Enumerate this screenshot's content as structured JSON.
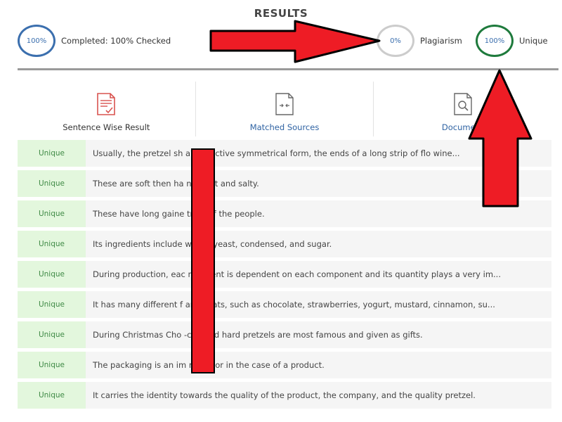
{
  "header": {
    "title": "RESULTS"
  },
  "stats": {
    "completed": {
      "ring": "100%",
      "label": "Completed: 100% Checked",
      "color": "#3b6fae"
    },
    "plagiarism": {
      "ring": "0%",
      "label": "Plagiarism",
      "color": "#cccccc"
    },
    "unique": {
      "ring": "100%",
      "label": "Unique",
      "color": "#1e7a3c"
    }
  },
  "tabs": [
    {
      "label": "Sentence Wise Result",
      "icon": "document-check-icon"
    },
    {
      "label": "Matched Sources",
      "icon": "document-compare-icon"
    },
    {
      "label": "Document",
      "icon": "document-search-icon"
    }
  ],
  "rows": [
    {
      "status": "Unique",
      "text": "Usually, the pretzel sh a distinctive symmetrical form, the ends of a long strip of flo wine..."
    },
    {
      "status": "Unique",
      "text": "These are soft then ha n sweet and salty."
    },
    {
      "status": "Unique",
      "text": "These have long gaine trust of the people."
    },
    {
      "status": "Unique",
      "text": "Its ingredients include water, yeast, condensed, and sugar."
    },
    {
      "status": "Unique",
      "text": "During production, eac mponent is dependent on each component and its quantity plays a very im..."
    },
    {
      "status": "Unique",
      "text": "It has many different f and coats, such as chocolate, strawberries, yogurt, mustard, cinnamon, su..."
    },
    {
      "status": "Unique",
      "text": "During Christmas Cho -covered hard pretzels are most famous and given as gifts."
    },
    {
      "status": "Unique",
      "text": "The packaging is an im nt factor in the case of a product."
    },
    {
      "status": "Unique",
      "text": "It carries the identity towards the quality of the product, the company, and the quality pretzel."
    }
  ],
  "annotations": {
    "arrow_color": "#ee1c25"
  }
}
